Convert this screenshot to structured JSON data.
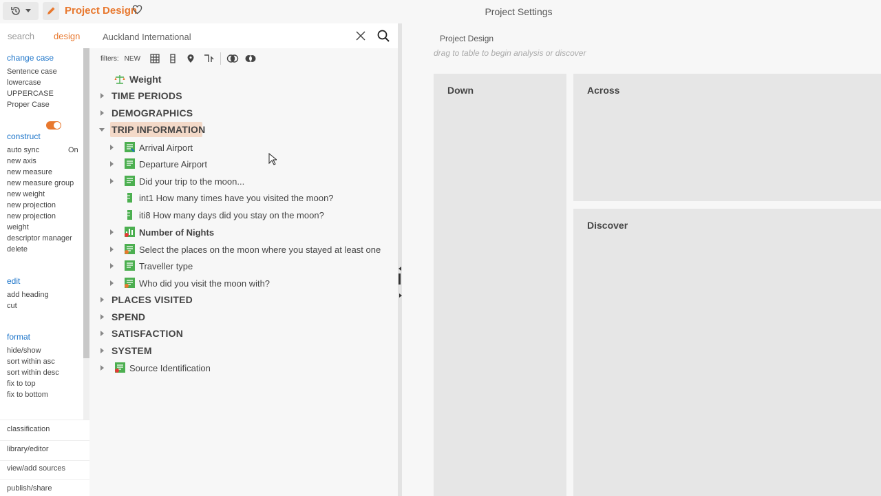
{
  "header": {
    "project_title": "Project Design",
    "settings_title": "Project Settings"
  },
  "sidebar": {
    "tabs": {
      "search": "search",
      "design": "design"
    },
    "sections": [
      {
        "title": "change case",
        "items": [
          "Sentence case",
          "lowercase",
          "UPPERCASE",
          "Proper Case"
        ]
      },
      {
        "title": "construct",
        "auto_sync_label": "auto sync",
        "auto_sync_state": "On",
        "items": [
          "new axis",
          "new measure",
          "new measure group",
          "new weight",
          "new projection",
          "weight",
          "descriptor manager",
          "delete"
        ],
        "items_raw": [
          "new axis",
          "new measure",
          "new measure group",
          "new weight",
          "new projection",
          "weight",
          "descriptor manager",
          "delete"
        ]
      },
      {
        "title": "edit",
        "items": [
          "add heading",
          "cut"
        ]
      },
      {
        "title": "format",
        "items": [
          "hide/show",
          "sort within asc",
          "sort within desc",
          "fix to top",
          "fix to bottom"
        ]
      }
    ],
    "bottom_links": [
      "classification",
      "library/editor",
      "view/add sources",
      "publish/share"
    ]
  },
  "search": {
    "value": "Auckland International"
  },
  "filters": {
    "label": "filters:",
    "new_label": "NEW"
  },
  "tree": {
    "weight": "Weight",
    "groups": [
      "TIME PERIODS",
      "DEMOGRAPHICS",
      "TRIP INFORMATION"
    ],
    "trip_items": [
      "Arrival Airport",
      "Departure Airport",
      "Did your trip to the moon...",
      "int1 How many times have you visited the moon?",
      "iti8 How many days did you stay on the moon?",
      "Number of Nights",
      "Select the places on the moon where you stayed at least one",
      "Traveller type",
      "Who did you visit the moon with?"
    ],
    "groups_after": [
      "PLACES VISITED",
      "SPEND",
      "SATISFACTION",
      "SYSTEM"
    ],
    "source_id": "Source Identification"
  },
  "canvas": {
    "label": "Project Design",
    "hint": "drag to table to begin analysis or discover",
    "zones": {
      "down": "Down",
      "across": "Across",
      "discover": "Discover"
    }
  },
  "colors": {
    "accent": "#e8782e",
    "link": "#1a73c9",
    "var_green": "#4caf50"
  }
}
